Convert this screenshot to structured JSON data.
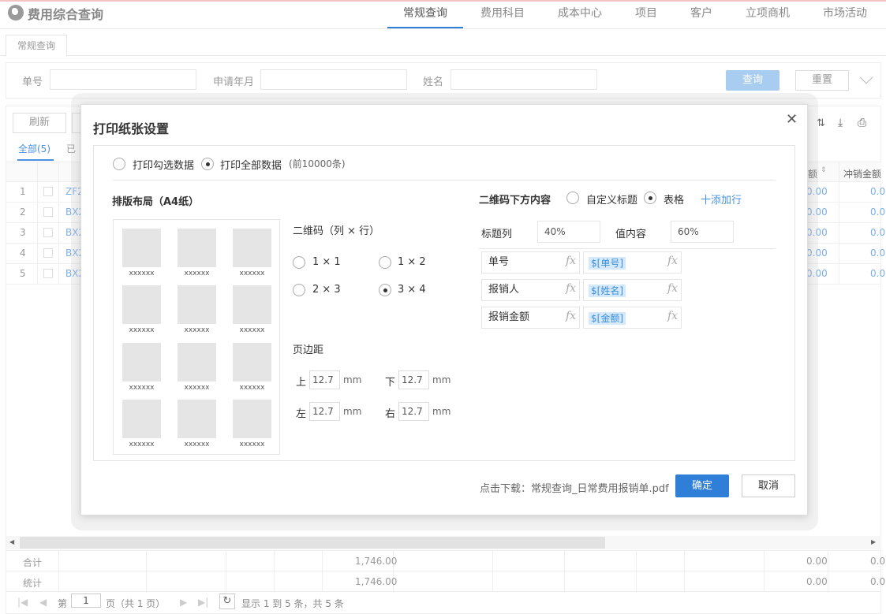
{
  "app": {
    "title": "费用综合查询"
  },
  "nav": {
    "tabs": [
      "常规查询",
      "费用科目",
      "成本中心",
      "项目",
      "客户",
      "立项商机",
      "市场活动"
    ]
  },
  "subtab": {
    "label": "常规查询"
  },
  "filter": {
    "no_label": "单号",
    "month_label": "申请年月",
    "name_label": "姓名",
    "query": "查询",
    "reset": "重置"
  },
  "toolbar": {
    "refresh": "刷新"
  },
  "grid": {
    "tab_all": "全部(5)",
    "tab_part": "已",
    "col_amount": "额",
    "col_writeoff": "冲销金额",
    "rows": [
      {
        "n": "1",
        "code": "ZF2",
        "a": "0.00",
        "b": "0.0"
      },
      {
        "n": "2",
        "code": "BX2",
        "a": "0.00",
        "b": "0.0"
      },
      {
        "n": "3",
        "code": "BX2",
        "a": "0.00",
        "b": "0.0"
      },
      {
        "n": "4",
        "code": "BX2",
        "a": "0.00",
        "b": "0.0"
      },
      {
        "n": "5",
        "code": "BX2",
        "a": "0.00",
        "b": "0.0"
      }
    ],
    "sum_label": "合计",
    "stat_label": "统计",
    "sum_total": "1,746.00",
    "stat_total": "1,746.00",
    "sum_a": "0.00",
    "sum_b": "0.0",
    "stat_a": "0.00",
    "stat_b": "0.0"
  },
  "pager": {
    "prefix": "第",
    "page": "1",
    "suffix": "页（共 1 页）",
    "summary": "显示 1 到 5 条，共 5 条"
  },
  "modal": {
    "title": "打印纸张设置",
    "print_selected": "打印勾选数据",
    "print_all": "打印全部数据",
    "print_all_note": "(前10000条)",
    "layout_title": "排版布局（A4纸）",
    "qr_label_text": "xxxxxx",
    "qr_grid_title": "二维码（列 × 行）",
    "qr_options": [
      "1 × 1",
      "1 × 2",
      "2 × 3",
      "3 × 4"
    ],
    "qr_selected": "3 × 4",
    "margin_title": "页边距",
    "margin": {
      "top_label": "上",
      "top": "12.7",
      "bottom_label": "下",
      "bottom": "12.7",
      "left_label": "左",
      "left": "12.7",
      "right_label": "右",
      "right": "12.7",
      "unit": "mm"
    },
    "below_title": "二维码下方内容",
    "opt_custom": "自定义标题",
    "opt_table": "表格",
    "add_row": "十添加行",
    "title_col_label": "标题列",
    "title_col_value": "40%",
    "value_col_label": "值内容",
    "value_col_value": "60%",
    "fields": [
      {
        "title": "单号",
        "value": "$[单号]"
      },
      {
        "title": "报销人",
        "value": "$[姓名]"
      },
      {
        "title": "报销金额",
        "value": "$[金额]"
      }
    ],
    "fx": "fx",
    "download": "点击下载：常规查询_日常费用报销单.pdf",
    "ok": "确定",
    "cancel": "取消"
  },
  "colors": {
    "accent": "#2f7fd8",
    "link": "#4a90e2",
    "tag_bg": "#d6e9fb"
  }
}
